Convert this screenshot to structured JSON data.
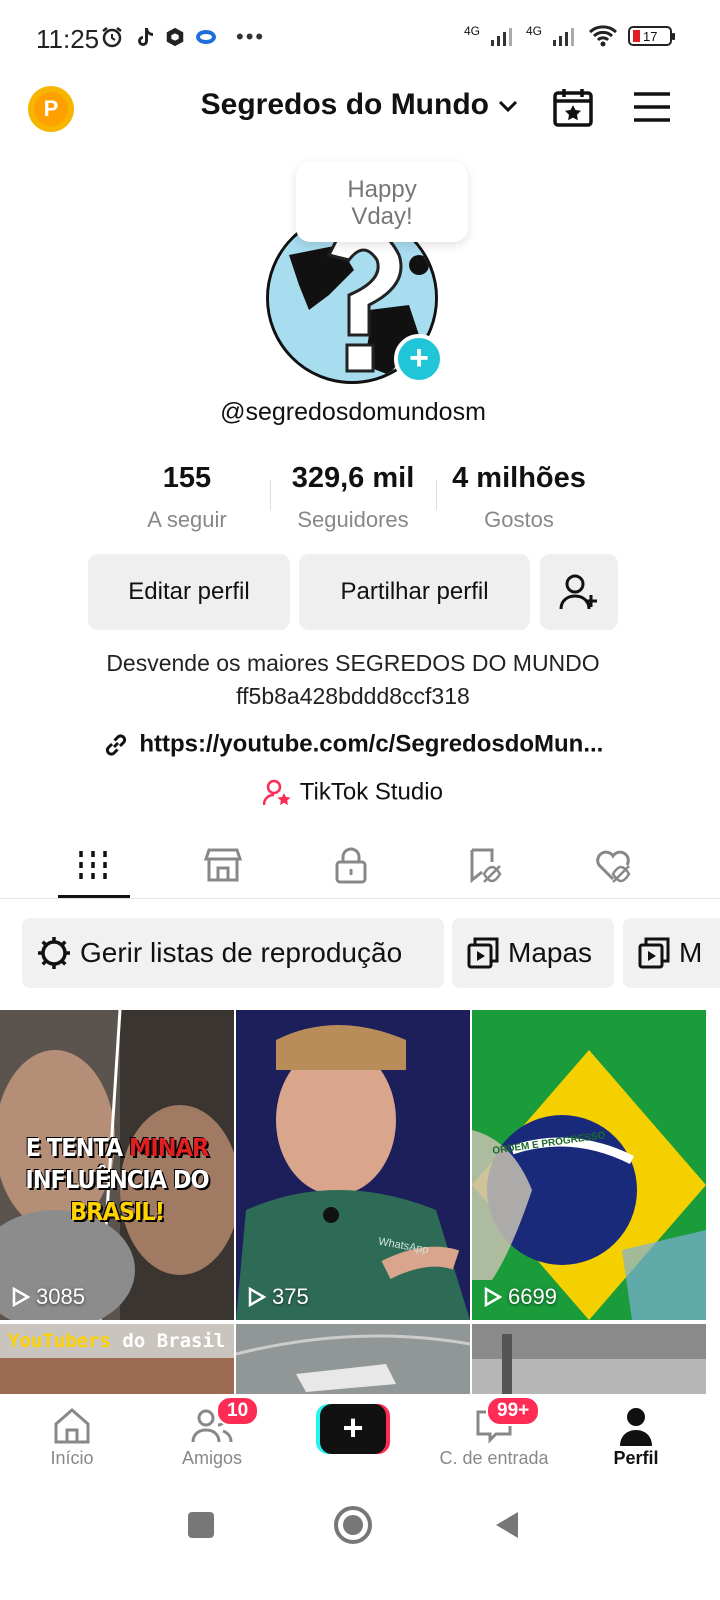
{
  "status_bar": {
    "time": "11:25",
    "network1": "4G",
    "network2": "4G",
    "battery": "17"
  },
  "header": {
    "coin_letter": "P",
    "title": "Segredos do Mundo",
    "chevron": "❯"
  },
  "profile": {
    "tooltip": "Happy\nVday!",
    "handle": "@segredosdomundosm",
    "avatar_plus": "+"
  },
  "stats": [
    {
      "value": "155",
      "label": "A seguir"
    },
    {
      "value": "329,6 mil",
      "label": "Seguidores"
    },
    {
      "value": "4 milhões",
      "label": "Gostos"
    }
  ],
  "buttons": {
    "edit": "Editar perfil",
    "share": "Partilhar perfil"
  },
  "bio": {
    "line1": "Desvende os maiores SEGREDOS DO MUNDO",
    "line2": "ff5b8a428bddd8ccf318",
    "link": "https://youtube.com/c/SegredosdoMun...",
    "studio": "TikTok Studio"
  },
  "tabs": [
    "videos-grid-icon",
    "shop-icon",
    "lock-icon",
    "repost-hidden-icon",
    "liked-hidden-icon"
  ],
  "chips": [
    {
      "label": "Gerir listas de reprodução",
      "icon": "gear-icon"
    },
    {
      "label": "Mapas",
      "icon": "playlist-icon"
    },
    {
      "label": "M",
      "icon": "playlist-icon"
    }
  ],
  "videos": [
    {
      "views": "3085",
      "caption_line1": "E TENTA",
      "caption_highlight1": "MINAR",
      "caption_line2": "INFLUÊNCIA DO",
      "caption_highlight2": "BRASIL!"
    },
    {
      "views": "375",
      "shirt_text": "WhatsApp"
    },
    {
      "views": "6699",
      "flag_text": "ORDEM E PROGRESSO"
    }
  ],
  "videos_row2": [
    {
      "caption_a": "YouTubers",
      "caption_b": " do Brasil"
    },
    {},
    {}
  ],
  "bottom_nav": {
    "home": "Início",
    "friends": "Amigos",
    "friends_badge": "10",
    "inbox": "C. de entrada",
    "inbox_badge": "99+",
    "profile": "Perfil",
    "create": "+"
  },
  "colors": {
    "accent_red": "#fe2c55",
    "accent_cyan": "#25f4ee",
    "avatar_plus": "#20c6d8",
    "coin": "#f7b500"
  }
}
